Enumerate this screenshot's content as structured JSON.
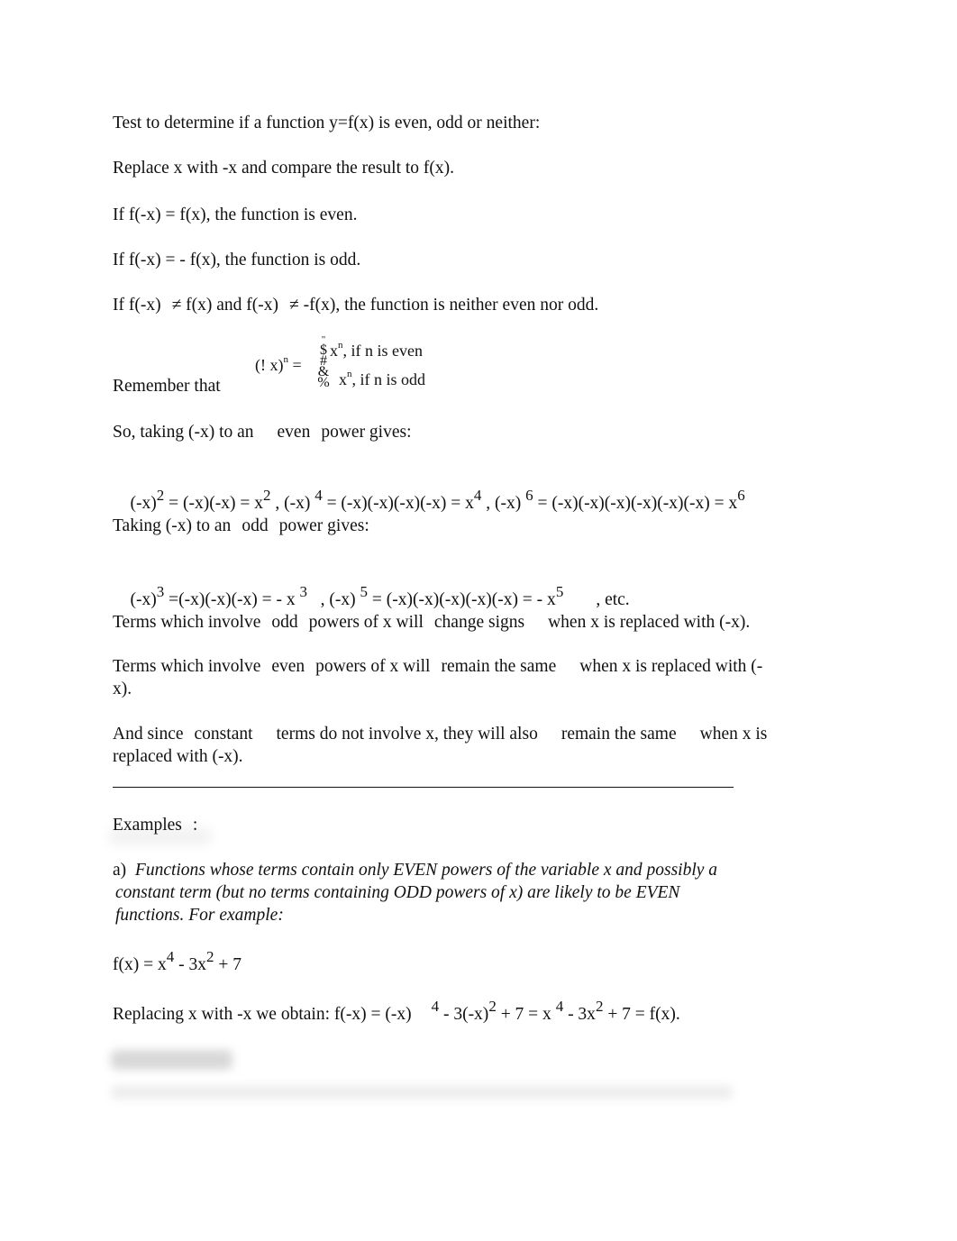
{
  "document": {
    "intro": {
      "title_line": "Test to determine if a function y=f(x) is even, odd or neither:",
      "replace_line": "Replace x with -x and compare the result to f(x).",
      "even_rule": "If f(-x) = f(x), the function is even.",
      "odd_rule": "If f(-x) = - f(x), the function is odd.",
      "neither_rule": {
        "part1": "If f(-x)",
        "part2": "≠ f(x) and f(-x)",
        "part3": "≠ -f(x), the function is neither even nor odd."
      }
    },
    "remember": {
      "label": "Remember that",
      "lhs": "(! x)",
      "lhs_exp": "n",
      "equals": "=",
      "brace_glyphs": "\" $ # & %",
      "case_even": {
        "base": "x",
        "exp": "n",
        "text": ", if n is even"
      },
      "case_odd": {
        "base": "x",
        "exp": "n",
        "text": ", if n is odd"
      }
    },
    "even_power": {
      "heading": {
        "a": "So, taking (-x) to an",
        "b": "even",
        "c": "power gives:"
      },
      "eq": [
        {
          "lhs": "(-x)",
          "lhs_exp": "2",
          "mid": " = (-x)(-x) = x",
          "rhs_exp": "2",
          "sep": " , "
        },
        {
          "lhs": "(-x) ",
          "lhs_exp": "4",
          "mid": " = (-x)(-x)(-x)(-x) = x",
          "rhs_exp": "4",
          "sep": " , "
        },
        {
          "lhs": "(-x) ",
          "lhs_exp": "6",
          "mid": " = (-x)(-x)(-x)(-x)(-x)(-x) = x",
          "rhs_exp": "6",
          "sep": ""
        }
      ]
    },
    "odd_power": {
      "heading": {
        "a": "Taking (-x) to an",
        "b": "odd",
        "c": "power gives:"
      },
      "eq": [
        {
          "lhs": "(-x)",
          "lhs_exp": "3",
          "mid": " =(-x)(-x)(-x) = - x ",
          "rhs_exp": "3",
          "sep": "   , "
        },
        {
          "lhs": "(-x) ",
          "lhs_exp": "5",
          "mid": " = (-x)(-x)(-x)(-x)(-x) = - x",
          "rhs_exp": "5",
          "sep": ""
        }
      ],
      "tail": ", etc."
    },
    "terms_odd": {
      "a": "Terms which involve",
      "b": "odd",
      "c": "powers of x will",
      "d": "change signs",
      "e": "when x is replaced with (-x)."
    },
    "terms_even": {
      "a": "Terms which involve",
      "b": "even",
      "c": "powers of x will",
      "d": "remain the same",
      "e": "when x is replaced with (-",
      "f": "x)."
    },
    "constant": {
      "a": "And since",
      "b": "constant",
      "c": "terms do not involve x, they will also",
      "d": "remain the same",
      "e": "when x is",
      "f": "replaced with (-x)."
    },
    "examples": {
      "heading": "Examples",
      "colon": ":",
      "a": {
        "label": "a)",
        "line1": "Functions whose terms contain only EVEN powers of the variable x and possibly a",
        "line2": "constant term (but no terms containing ODD powers of x) are likely to be EVEN",
        "line3": "functions. For example:"
      },
      "fx": {
        "p1": "f(x) = x",
        "e1": "4",
        "p2": " - 3x",
        "e2": "2",
        "p3": " + 7"
      },
      "replacing": {
        "p1": "Replacing x with -x we obtain: f(-x) = (-x)",
        "e1": "4",
        "p2": " - 3(-x)",
        "e2": "2",
        "p3": " + 7 = x ",
        "e3": "4",
        "p4": " - 3x",
        "e4": "2",
        "p5": " + 7 = f(x)."
      }
    }
  }
}
